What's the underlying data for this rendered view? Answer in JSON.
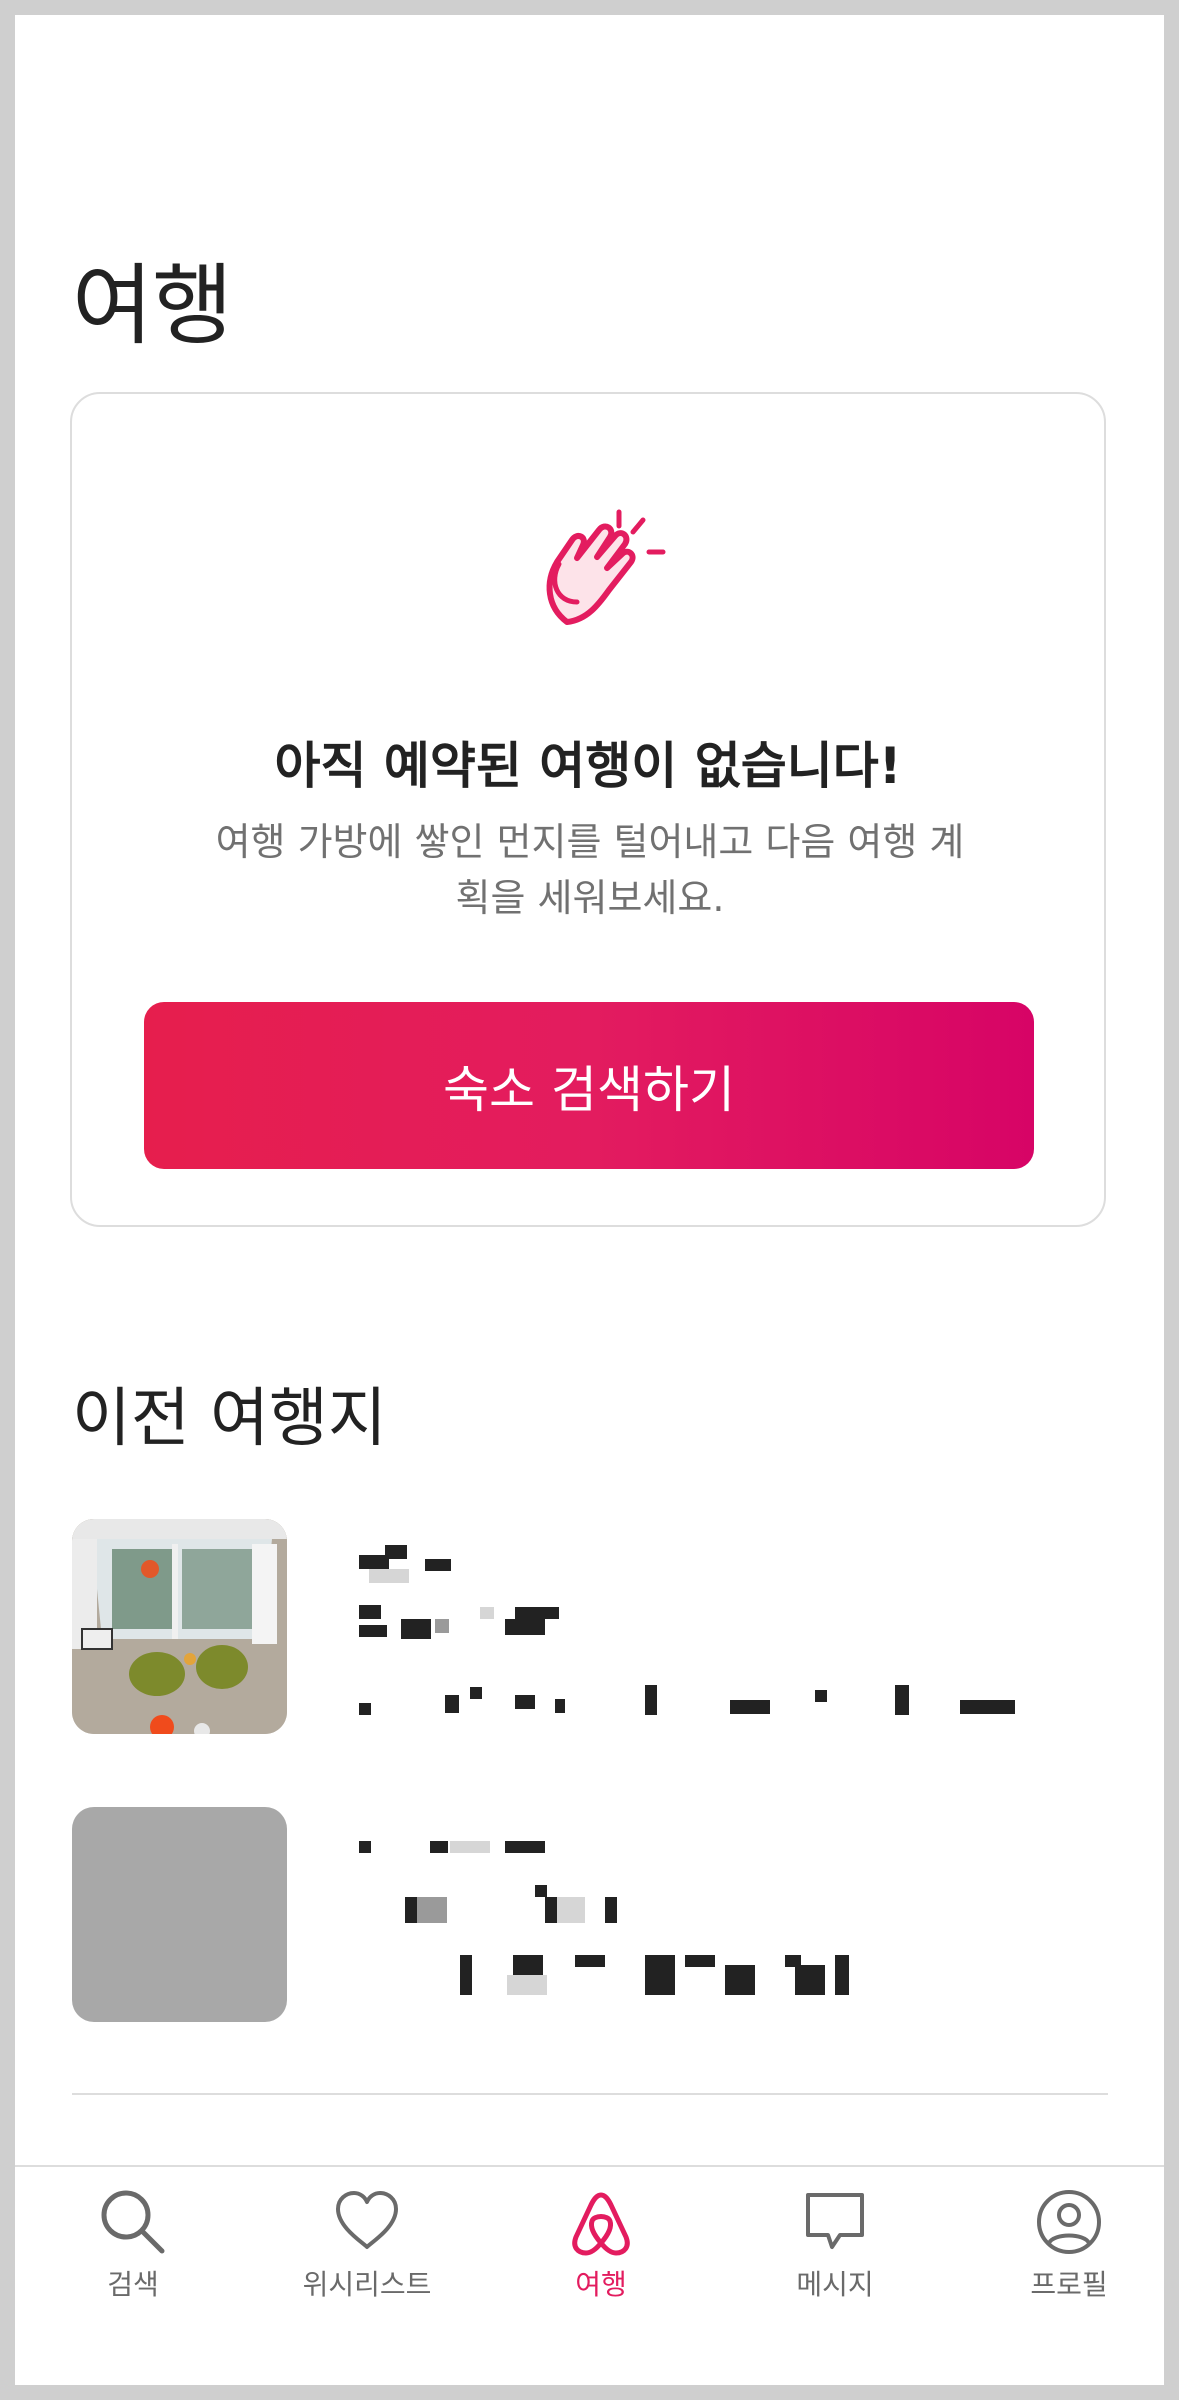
{
  "header": {
    "title": "여행"
  },
  "empty_state": {
    "icon": "clapping-hands-icon",
    "heading": "아직 예약된 여행이 없습니다!",
    "subtext": "여행 가방에 쌓인 먼지를 털어내고 다음 여행 계획을 세워보세요.",
    "button_label": "숙소 검색하기"
  },
  "past_trips": {
    "title": "이전 여행지"
  },
  "bottom_nav": {
    "items": [
      {
        "label": "검색",
        "icon": "search-icon",
        "active": false
      },
      {
        "label": "위시리스트",
        "icon": "heart-icon",
        "active": false
      },
      {
        "label": "여행",
        "icon": "airbnb-logo-icon",
        "active": true
      },
      {
        "label": "메시지",
        "icon": "message-icon",
        "active": false
      },
      {
        "label": "프로필",
        "icon": "profile-icon",
        "active": false
      }
    ]
  },
  "colors": {
    "brand": "#e31c5f",
    "text_primary": "#222222",
    "text_secondary": "#717171",
    "border": "#dddddd"
  }
}
